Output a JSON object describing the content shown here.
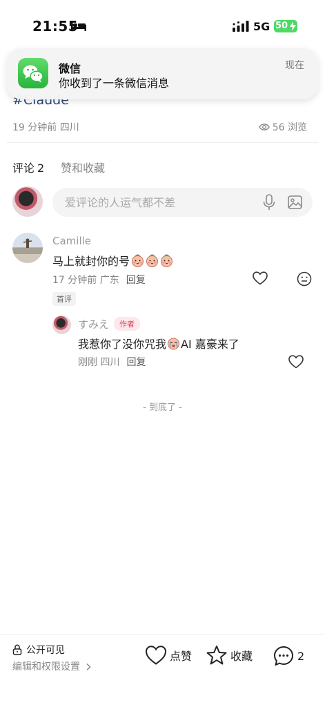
{
  "status_bar": {
    "time": "21:55",
    "network": "5G",
    "battery": "50"
  },
  "notification": {
    "app_name": "微信",
    "message": "你收到了一条微信消息",
    "time": "现在"
  },
  "post": {
    "tag": "#Claude",
    "meta": "19 分钟前 四川",
    "views": "56 浏览"
  },
  "tabs": {
    "comments_label": "评论",
    "comments_count": "2",
    "likes_label": "赞和收藏"
  },
  "comment_input": {
    "placeholder": "爱评论的人运气都不差"
  },
  "comments": [
    {
      "author": "Camille",
      "text": "马上就封你的号",
      "meta": "17 分钟前 广东",
      "reply_label": "回复",
      "badge": "首评",
      "sticker_icons": [
        "blush-face-sticker-icon",
        "blush-face-sticker-icon",
        "blush-face-sticker-icon"
      ],
      "replies": [
        {
          "author": "すみえ",
          "author_badge": "作者",
          "text_before": "我惹你了没你咒我",
          "sticker_icon": "crying-face-sticker-icon",
          "text_after": "AI 嘉豪来了",
          "meta": "刚刚 四川",
          "reply_label": "回复"
        }
      ]
    }
  ],
  "end_marker": "- 到底了 -",
  "bottom_bar": {
    "visibility": "公开可见",
    "permission_settings": "编辑和权限设置",
    "like_label": "点赞",
    "collect_label": "收藏",
    "comment_count": "2"
  },
  "colors": {
    "wechat_green": "#2dc14a",
    "battery_green": "#4cd964",
    "author_badge": "#e0405a",
    "tag_blue": "#2c4a7c"
  }
}
